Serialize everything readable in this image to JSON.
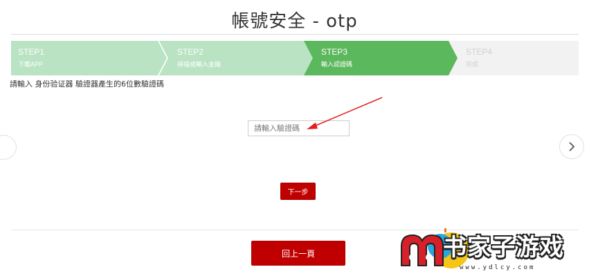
{
  "page": {
    "title": "帳號安全 - otp"
  },
  "steps": [
    {
      "title": "STEP1",
      "subtitle": "下載APP",
      "state": "done"
    },
    {
      "title": "STEP2",
      "subtitle": "掃描或輸入金鑰",
      "state": "done"
    },
    {
      "title": "STEP3",
      "subtitle": "輸入認證碼",
      "state": "active"
    },
    {
      "title": "STEP4",
      "subtitle": "完成",
      "state": "pending"
    }
  ],
  "form": {
    "instruction": "請輸入 身份验证器 驗證器產生的6位數驗證碼",
    "code_placeholder": "請輸入驗證碼",
    "code_value": "",
    "next_label": "下一步",
    "back_label": "回上一頁"
  },
  "carousel": {
    "prev_icon": "chevron-left-icon",
    "next_icon": "chevron-right-icon"
  },
  "watermark": {
    "logo_text": "书家子游戏",
    "url": "www.ydlcy.com"
  },
  "colors": {
    "step_done": "#b9e3c3",
    "step_active": "#5cb85c",
    "step_pending": "#f2f2f2",
    "button_red": "#c00000",
    "annotation_arrow": "#e02020"
  }
}
